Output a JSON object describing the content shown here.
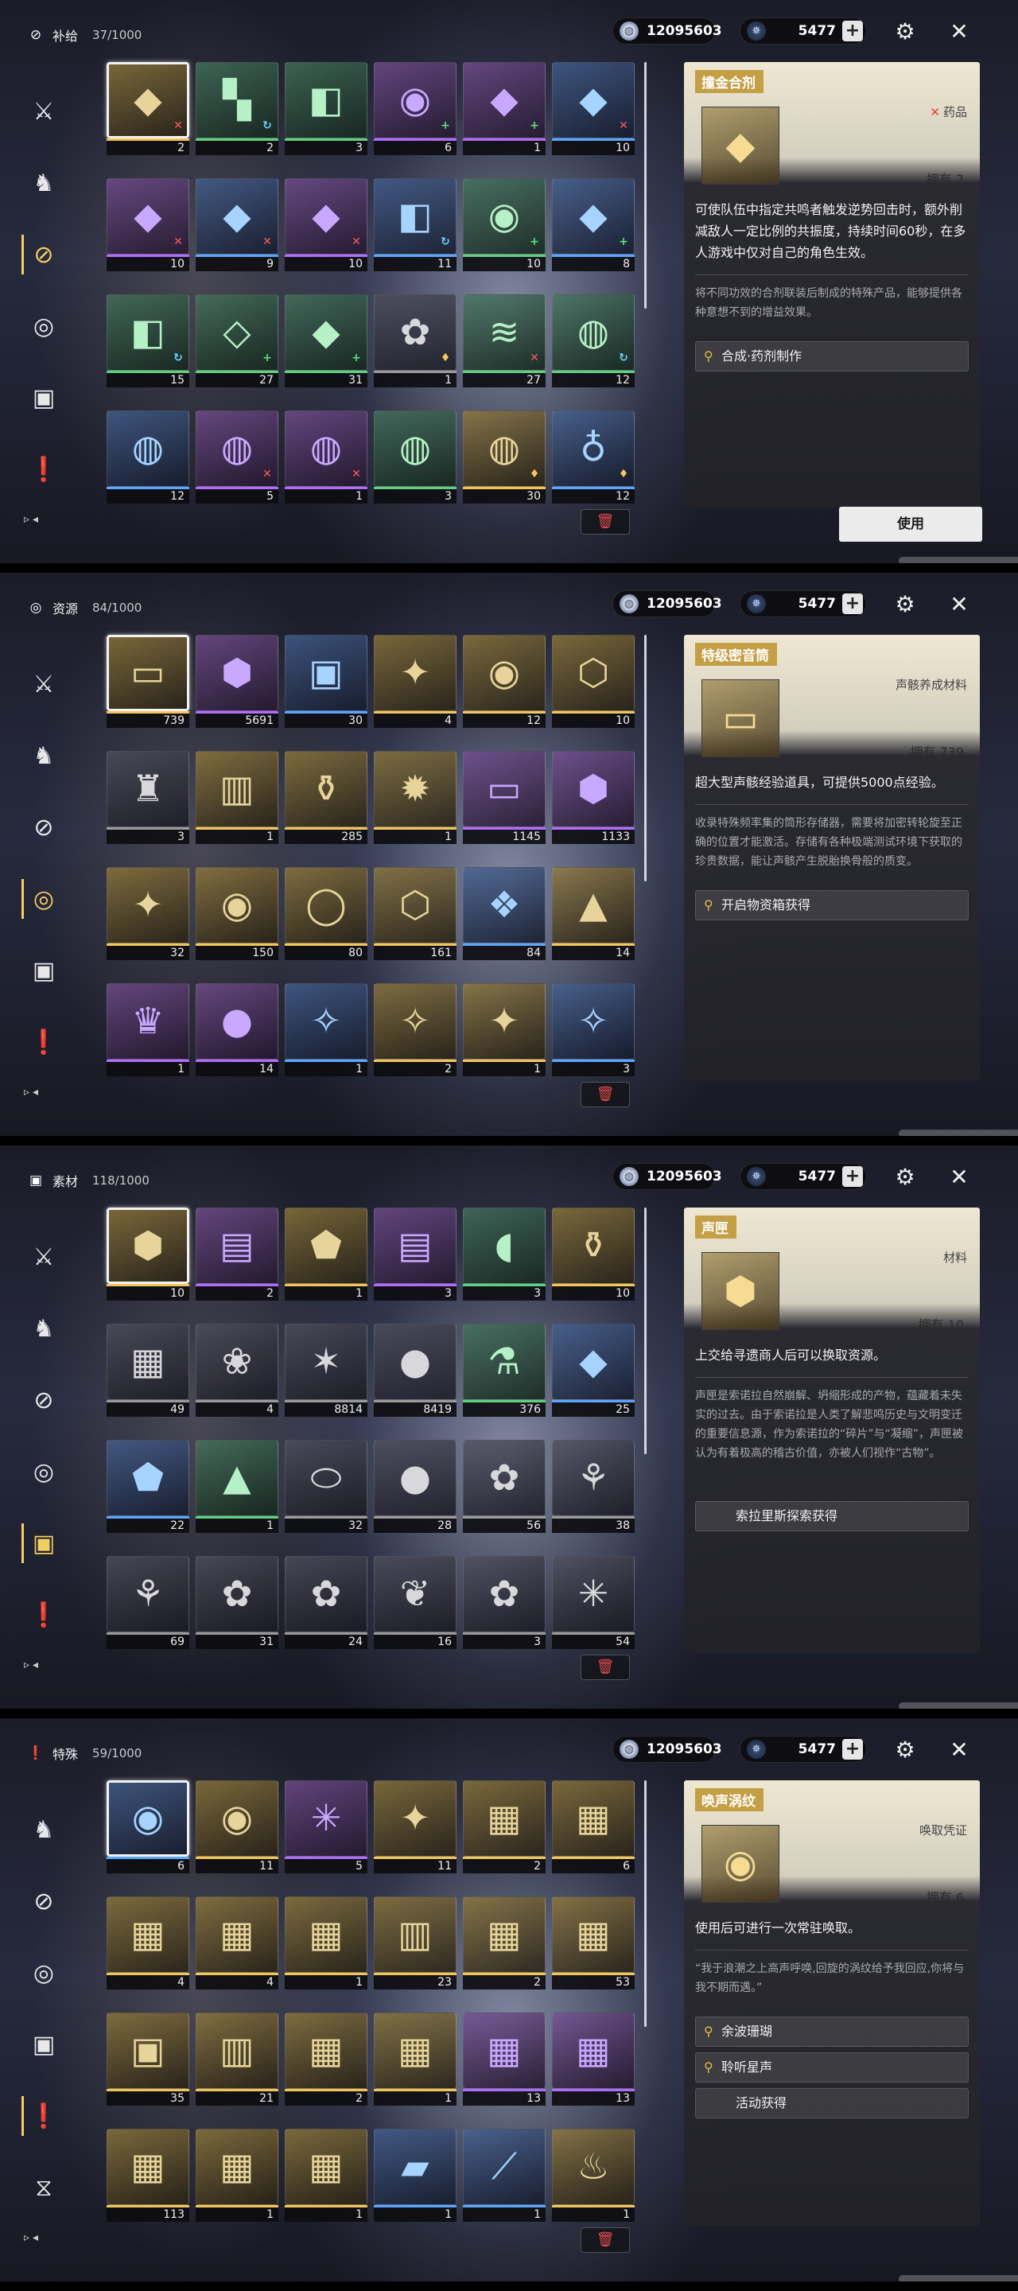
{
  "currency": {
    "shell_credit": "12095603",
    "astrite": "5477",
    "plus": "+"
  },
  "screens": [
    {
      "category": "补给",
      "count": "37/1000",
      "active_tab": 2,
      "items": [
        {
          "q": "q5",
          "icon": "◆",
          "count": "2",
          "badge": "x",
          "sel": true
        },
        {
          "q": "q2",
          "icon": "▚",
          "count": "2",
          "badge": "sp"
        },
        {
          "q": "q2",
          "icon": "◧",
          "count": "3",
          "badge": ""
        },
        {
          "q": "q4",
          "icon": "◉",
          "count": "6",
          "badge": "up"
        },
        {
          "q": "q4",
          "icon": "◆",
          "count": "1",
          "badge": "up"
        },
        {
          "q": "q3",
          "icon": "◆",
          "count": "10",
          "badge": "x"
        },
        {
          "q": "q4",
          "icon": "◆",
          "count": "10",
          "badge": "x"
        },
        {
          "q": "q3",
          "icon": "◆",
          "count": "9",
          "badge": "x"
        },
        {
          "q": "q4",
          "icon": "◆",
          "count": "10",
          "badge": "x"
        },
        {
          "q": "q3",
          "icon": "◧",
          "count": "11",
          "badge": "sp"
        },
        {
          "q": "q2",
          "icon": "◉",
          "count": "10",
          "badge": "up"
        },
        {
          "q": "q3",
          "icon": "◆",
          "count": "8",
          "badge": "up"
        },
        {
          "q": "q2",
          "icon": "◧",
          "count": "15",
          "badge": "sp"
        },
        {
          "q": "q2",
          "icon": "◇",
          "count": "27",
          "badge": "up"
        },
        {
          "q": "q2",
          "icon": "◆",
          "count": "31",
          "badge": "up"
        },
        {
          "q": "q1",
          "icon": "✿",
          "count": "1",
          "badge": "a"
        },
        {
          "q": "q2",
          "icon": "≋",
          "count": "27",
          "badge": "x"
        },
        {
          "q": "q2",
          "icon": "◍",
          "count": "12",
          "badge": "sp"
        },
        {
          "q": "q3",
          "icon": "◍",
          "count": "12",
          "badge": ""
        },
        {
          "q": "q4",
          "icon": "◍",
          "count": "5",
          "badge": "x"
        },
        {
          "q": "q4",
          "icon": "◍",
          "count": "1",
          "badge": "x"
        },
        {
          "q": "q2",
          "icon": "◍",
          "count": "3",
          "badge": ""
        },
        {
          "q": "q5",
          "icon": "◍",
          "count": "30",
          "badge": "a"
        },
        {
          "q": "q3",
          "icon": "♁",
          "count": "12",
          "badge": "a"
        }
      ],
      "detail": {
        "name": "撞金合剂",
        "type": "药品",
        "type_mark": "✕",
        "owned": "拥有 2",
        "icon": "◆",
        "summary": "可使队伍中指定共鸣者触发逆势回击时，额外削减敌人一定比例的共振度，持续时间60秒，在多人游戏中仅对自己的角色生效。",
        "desc": "将不同功效的合剂联装后制成的特殊产品，能够提供各种意想不到的增益效果。",
        "sources": [
          "合成·药剂制作"
        ],
        "use_label": "使用"
      }
    },
    {
      "category": "资源",
      "count": "84/1000",
      "active_tab": 3,
      "items": [
        {
          "q": "q5",
          "icon": "▭",
          "count": "739",
          "badge": "",
          "sel": true
        },
        {
          "q": "q4",
          "icon": "⬢",
          "count": "5691",
          "badge": ""
        },
        {
          "q": "q3",
          "icon": "▣",
          "count": "30",
          "badge": ""
        },
        {
          "q": "q5",
          "icon": "✦",
          "count": "4",
          "badge": ""
        },
        {
          "q": "q5",
          "icon": "◉",
          "count": "12",
          "badge": ""
        },
        {
          "q": "q5",
          "icon": "⬡",
          "count": "10",
          "badge": ""
        },
        {
          "q": "q1",
          "icon": "♜",
          "count": "3",
          "badge": ""
        },
        {
          "q": "q5",
          "icon": "▥",
          "count": "1",
          "badge": ""
        },
        {
          "q": "q5",
          "icon": "⚱",
          "count": "285",
          "badge": ""
        },
        {
          "q": "q5",
          "icon": "✹",
          "count": "1",
          "badge": ""
        },
        {
          "q": "q4",
          "icon": "▭",
          "count": "1145",
          "badge": ""
        },
        {
          "q": "q4",
          "icon": "⬢",
          "count": "1133",
          "badge": ""
        },
        {
          "q": "q5",
          "icon": "✦",
          "count": "32",
          "badge": ""
        },
        {
          "q": "q5",
          "icon": "◉",
          "count": "150",
          "badge": ""
        },
        {
          "q": "q5",
          "icon": "◯",
          "count": "80",
          "badge": ""
        },
        {
          "q": "q5",
          "icon": "⬡",
          "count": "161",
          "badge": ""
        },
        {
          "q": "q3",
          "icon": "❖",
          "count": "84",
          "badge": ""
        },
        {
          "q": "q5",
          "icon": "▲",
          "count": "14",
          "badge": ""
        },
        {
          "q": "q4",
          "icon": "♛",
          "count": "1",
          "badge": ""
        },
        {
          "q": "q4",
          "icon": "●",
          "count": "14",
          "badge": ""
        },
        {
          "q": "q3",
          "icon": "✧",
          "count": "1",
          "badge": ""
        },
        {
          "q": "q5",
          "icon": "✧",
          "count": "2",
          "badge": ""
        },
        {
          "q": "q5",
          "icon": "✦",
          "count": "1",
          "badge": ""
        },
        {
          "q": "q3",
          "icon": "✧",
          "count": "3",
          "badge": ""
        }
      ],
      "detail": {
        "name": "特级密音筒",
        "type": "声骸养成材料",
        "type_mark": "",
        "owned": "拥有 739",
        "icon": "▭",
        "summary": "超大型声骸经验道具，可提供5000点经验。",
        "desc": "收录特殊频率集的筒形存储器，需要将加密转轮旋至正确的位置才能激活。存储有各种极端测试环境下获取的珍贵数据，能让声骸产生脱胎换骨般的质变。",
        "sources": [
          "开启物资箱获得"
        ],
        "use_label": ""
      }
    },
    {
      "category": "素材",
      "count": "118/1000",
      "active_tab": 4,
      "items": [
        {
          "q": "q5",
          "icon": "⬢",
          "count": "10",
          "badge": "",
          "sel": true
        },
        {
          "q": "q4",
          "icon": "▤",
          "count": "2",
          "badge": ""
        },
        {
          "q": "q5",
          "icon": "⬟",
          "count": "1",
          "badge": ""
        },
        {
          "q": "q4",
          "icon": "▤",
          "count": "3",
          "badge": ""
        },
        {
          "q": "q2",
          "icon": "◖",
          "count": "3",
          "badge": ""
        },
        {
          "q": "q5",
          "icon": "⚱",
          "count": "10",
          "badge": ""
        },
        {
          "q": "q1",
          "icon": "▦",
          "count": "49",
          "badge": ""
        },
        {
          "q": "q1",
          "icon": "❀",
          "count": "4",
          "badge": ""
        },
        {
          "q": "q1",
          "icon": "✶",
          "count": "8814",
          "badge": ""
        },
        {
          "q": "q1",
          "icon": "●",
          "count": "8419",
          "badge": ""
        },
        {
          "q": "q2",
          "icon": "⚗",
          "count": "376",
          "badge": ""
        },
        {
          "q": "q3",
          "icon": "◆",
          "count": "25",
          "badge": ""
        },
        {
          "q": "q3",
          "icon": "⬟",
          "count": "22",
          "badge": ""
        },
        {
          "q": "q2",
          "icon": "▲",
          "count": "1",
          "badge": ""
        },
        {
          "q": "q1",
          "icon": "⬭",
          "count": "32",
          "badge": ""
        },
        {
          "q": "q1",
          "icon": "●",
          "count": "28",
          "badge": ""
        },
        {
          "q": "q1",
          "icon": "✿",
          "count": "56",
          "badge": ""
        },
        {
          "q": "q1",
          "icon": "⚘",
          "count": "38",
          "badge": ""
        },
        {
          "q": "q1",
          "icon": "⚘",
          "count": "69",
          "badge": ""
        },
        {
          "q": "q1",
          "icon": "✿",
          "count": "31",
          "badge": ""
        },
        {
          "q": "q1",
          "icon": "✿",
          "count": "24",
          "badge": ""
        },
        {
          "q": "q1",
          "icon": "❦",
          "count": "16",
          "badge": ""
        },
        {
          "q": "q1",
          "icon": "✿",
          "count": "3",
          "badge": ""
        },
        {
          "q": "q1",
          "icon": "✳",
          "count": "54",
          "badge": ""
        }
      ],
      "detail": {
        "name": "声匣",
        "type": "材料",
        "type_mark": "",
        "owned": "拥有 10",
        "icon": "⬢",
        "summary": "上交给寻遗商人后可以换取资源。",
        "desc": "声匣是索诺拉自然崩解、坍缩形成的产物，蕴藏着未失实的过去。由于索诺拉是人类了解悲鸣历史与文明变迁的重要信息源，作为索诺拉的“碎片”与“凝缩”，声匣被认为有着极高的稽古价值，亦被人们视作“古物”。",
        "sources": [
          "索拉里斯探索获得"
        ],
        "use_label": ""
      }
    },
    {
      "category": "特殊",
      "count": "59/1000",
      "active_tab": 5,
      "items": [
        {
          "q": "q3",
          "icon": "◉",
          "count": "6",
          "badge": "",
          "sel": true
        },
        {
          "q": "q5",
          "icon": "◉",
          "count": "11",
          "badge": ""
        },
        {
          "q": "q4",
          "icon": "✳",
          "count": "5",
          "badge": ""
        },
        {
          "q": "q5",
          "icon": "✦",
          "count": "11",
          "badge": ""
        },
        {
          "q": "q5",
          "icon": "▦",
          "count": "2",
          "badge": ""
        },
        {
          "q": "q5",
          "icon": "▦",
          "count": "6",
          "badge": ""
        },
        {
          "q": "q5",
          "icon": "▦",
          "count": "4",
          "badge": ""
        },
        {
          "q": "q5",
          "icon": "▦",
          "count": "4",
          "badge": ""
        },
        {
          "q": "q5",
          "icon": "▦",
          "count": "1",
          "badge": ""
        },
        {
          "q": "q5",
          "icon": "▥",
          "count": "23",
          "badge": ""
        },
        {
          "q": "q5",
          "icon": "▦",
          "count": "2",
          "badge": ""
        },
        {
          "q": "q5",
          "icon": "▦",
          "count": "53",
          "badge": ""
        },
        {
          "q": "q5",
          "icon": "▣",
          "count": "35",
          "badge": ""
        },
        {
          "q": "q5",
          "icon": "▥",
          "count": "21",
          "badge": ""
        },
        {
          "q": "q5",
          "icon": "▦",
          "count": "2",
          "badge": ""
        },
        {
          "q": "q5",
          "icon": "▦",
          "count": "1",
          "badge": ""
        },
        {
          "q": "q4",
          "icon": "▦",
          "count": "13",
          "badge": ""
        },
        {
          "q": "q4",
          "icon": "▦",
          "count": "13",
          "badge": ""
        },
        {
          "q": "q5",
          "icon": "▦",
          "count": "113",
          "badge": ""
        },
        {
          "q": "q5",
          "icon": "▦",
          "count": "1",
          "badge": ""
        },
        {
          "q": "q5",
          "icon": "▦",
          "count": "1",
          "badge": ""
        },
        {
          "q": "q3",
          "icon": "▰",
          "count": "1",
          "badge": ""
        },
        {
          "q": "q3",
          "icon": "⟋",
          "count": "1",
          "badge": ""
        },
        {
          "q": "q5",
          "icon": "♨",
          "count": "1",
          "badge": ""
        }
      ],
      "detail": {
        "name": "唤声涡纹",
        "type": "唤取凭证",
        "type_mark": "",
        "owned": "拥有 6",
        "icon": "◉",
        "summary": "使用后可进行一次常驻唤取。",
        "desc": "“我于浪潮之上高声呼唤,回旋的涡纹给予我回应,你将与我不期而遇。”",
        "sources": [
          "余波珊瑚",
          "聆听星声",
          "活动获得"
        ],
        "use_label": ""
      }
    }
  ],
  "sidebar": [
    {
      "name": "weapon-icon",
      "glyph": "⚔"
    },
    {
      "name": "echo-icon",
      "glyph": "♞"
    },
    {
      "name": "supply-icon",
      "glyph": "⊘"
    },
    {
      "name": "resource-icon",
      "glyph": "◎"
    },
    {
      "name": "material-icon",
      "glyph": "▣"
    },
    {
      "name": "quest-item-icon",
      "glyph": "❗"
    },
    {
      "name": "special-icon",
      "glyph": "⧖"
    }
  ]
}
